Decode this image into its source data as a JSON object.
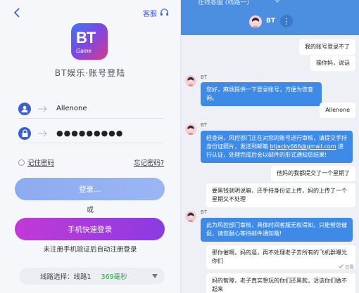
{
  "login": {
    "back_icon": "chevron-left-icon",
    "support_label": "客服",
    "support_icon": "headset-icon",
    "logo_text": "BT",
    "logo_sub": "Game",
    "title": "BT娱乐·账号登陆",
    "username_value": "Allenone",
    "password_value": "●●●●●●●●●",
    "remember_label": "记住密码",
    "forgot_label": "忘记密码?",
    "login_button": "登录...",
    "or_text": "或",
    "phone_login_button": "手机快速登录",
    "hint_text": "未注册手机验证后自动注册登录",
    "line_label": "线路选择：线路1",
    "line_latency": "369毫秒",
    "accent_color": "#3a5fcf"
  },
  "chat": {
    "tab_label": "在线客服 (线路一)",
    "agent_name": "BT",
    "messages": [
      {
        "from": "user",
        "text": "我的账号登录不了"
      },
      {
        "from": "user",
        "text": "操你妈，说话"
      },
      {
        "from": "agent",
        "name": "BT",
        "text": "您好，麻烦提供一下登录账号，方便为您查询。"
      },
      {
        "from": "user",
        "text": "Allenone"
      },
      {
        "from": "agent",
        "name": "BT",
        "text_pre": "经查询，风控部门正在对您的账号进行审核，请提交手持身份证照片，发送到邮箱 ",
        "email": "btjacky666@gmail.com",
        "text_post": " 进行认证，处理完成后会以邮件的形式通知您结果!"
      },
      {
        "from": "user",
        "text": "他妈的我都提交了一个星期了"
      },
      {
        "from": "user",
        "text": "要黑钱就明说嘛，还手持身份证上传，妈的上传了一个星期又不处理"
      },
      {
        "from": "agent",
        "name": "BT",
        "text": "此为风控部门审核，具体时间客服无权得知，只能帮您催促，请您耐心等待邮件通知哦!"
      },
      {
        "from": "user",
        "text": "那你催啊，妈的逼，再不处理老子去所有的飞机群曝光你们"
      },
      {
        "from": "user",
        "text": "妈的智障，老子真实想玩的你们还黑款，活该你们做不起来"
      }
    ],
    "read_label": "已看",
    "user_bubble_color": "#ffffff",
    "agent_bubble_color": "#3d8be6"
  }
}
